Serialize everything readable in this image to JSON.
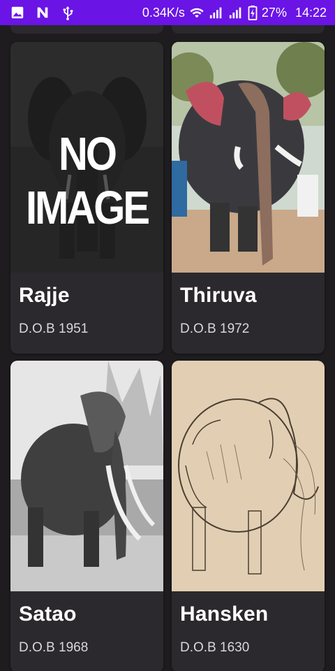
{
  "status_bar": {
    "network_speed": "0.34K/s",
    "battery_percent": "27%",
    "time": "14:22",
    "left_icons": [
      "gallery-icon",
      "n-app-icon",
      "usb-icon"
    ],
    "right_icons": [
      "wifi-icon",
      "signal-icon",
      "signal-icon-2",
      "battery-charging-icon"
    ]
  },
  "cards": [
    {
      "name": "Rajje",
      "dob": "D.O.B 1951",
      "image": "no-image-placeholder",
      "placeholder_text": "NO IMAGE"
    },
    {
      "name": "Thiruva",
      "dob": "D.O.B 1972",
      "image": "decorated-elephant-photo"
    },
    {
      "name": "Satao",
      "dob": "D.O.B 1968",
      "image": "tusker-bw-photo"
    },
    {
      "name": "Hansken",
      "dob": "D.O.B 1630",
      "image": "elephant-sketch"
    }
  ],
  "colors": {
    "status_bar": "#6a14e6",
    "background": "#1e1c1f",
    "card": "#2b292d",
    "title": "#ffffff",
    "subtitle": "#d9d7da"
  }
}
